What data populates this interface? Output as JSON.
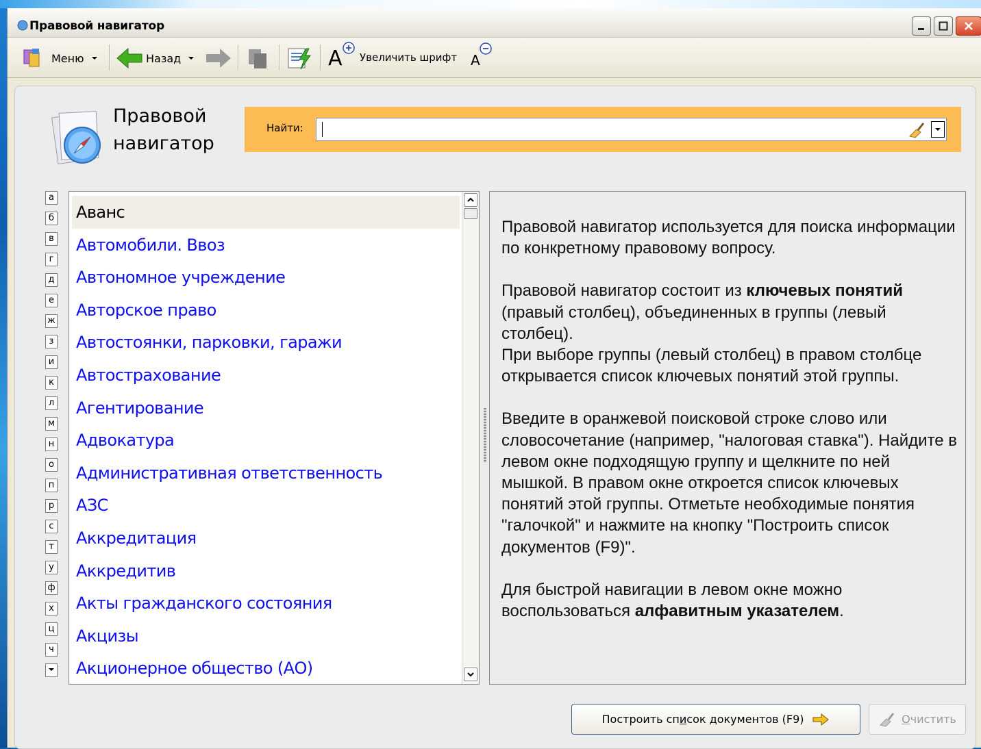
{
  "window": {
    "title": "Правовой навигатор"
  },
  "toolbar": {
    "menu_label": "Меню",
    "back_label": "Назад",
    "font_increase_label": "Увеличить шрифт"
  },
  "header": {
    "title_line1": "Правовой",
    "title_line2": "навигатор"
  },
  "search": {
    "label": "Найти:",
    "value": "",
    "placeholder": ""
  },
  "alphabet": [
    "а",
    "б",
    "в",
    "г",
    "д",
    "е",
    "ж",
    "з",
    "и",
    "к",
    "л",
    "м",
    "н",
    "о",
    "п",
    "р",
    "с",
    "т",
    "у",
    "ф",
    "х",
    "ц",
    "ч"
  ],
  "groups": {
    "items": [
      "Аванс",
      "Автомобили. Ввоз",
      "Автономное учреждение",
      "Авторское право",
      "Автостоянки, парковки, гаражи",
      "Автострахование",
      "Агентирование",
      "Адвокатура",
      "Административная ответственность",
      "АЗС",
      "Аккредитация",
      "Аккредитив",
      "Акты гражданского состояния",
      "Акцизы",
      "Акционерное общество (АО)"
    ],
    "selected_index": 0
  },
  "info": {
    "p1": "Правовой навигатор используется для поиска информации по конкретному правовому вопросу.",
    "p2_a": "Правовой навигатор состоит из ",
    "p2_bold": "ключевых понятий",
    "p2_b": " (правый столбец), объединенных в группы (левый столбец).",
    "p2_c": "При выборе группы (левый столбец) в правом столбце открывается список ключевых понятий этой группы.",
    "p3": "Введите в оранжевой поисковой строке слово или словосочетание (например, \"налоговая ставка\"). Найдите в левом окне подходящую группу и щелкните по ней мышкой. В правом окне откроется список ключевых понятий этой группы. Отметьте необходимые понятия \"галочкой\" и нажмите на кнопку \"Построить список документов (F9)\".",
    "p4_a": "Для быстрой навигации в левом окне можно воспользоваться ",
    "p4_bold": "алфавитным указателем",
    "p4_b": "."
  },
  "buttons": {
    "build_pre": "Построить сп",
    "build_u": "и",
    "build_post": "сок документов (F9)",
    "clear_u": "О",
    "clear_post": "чистить"
  },
  "colors": {
    "search_bar": "#fdbb53",
    "link": "#1010ee",
    "window_bg": "#ece9d8"
  }
}
